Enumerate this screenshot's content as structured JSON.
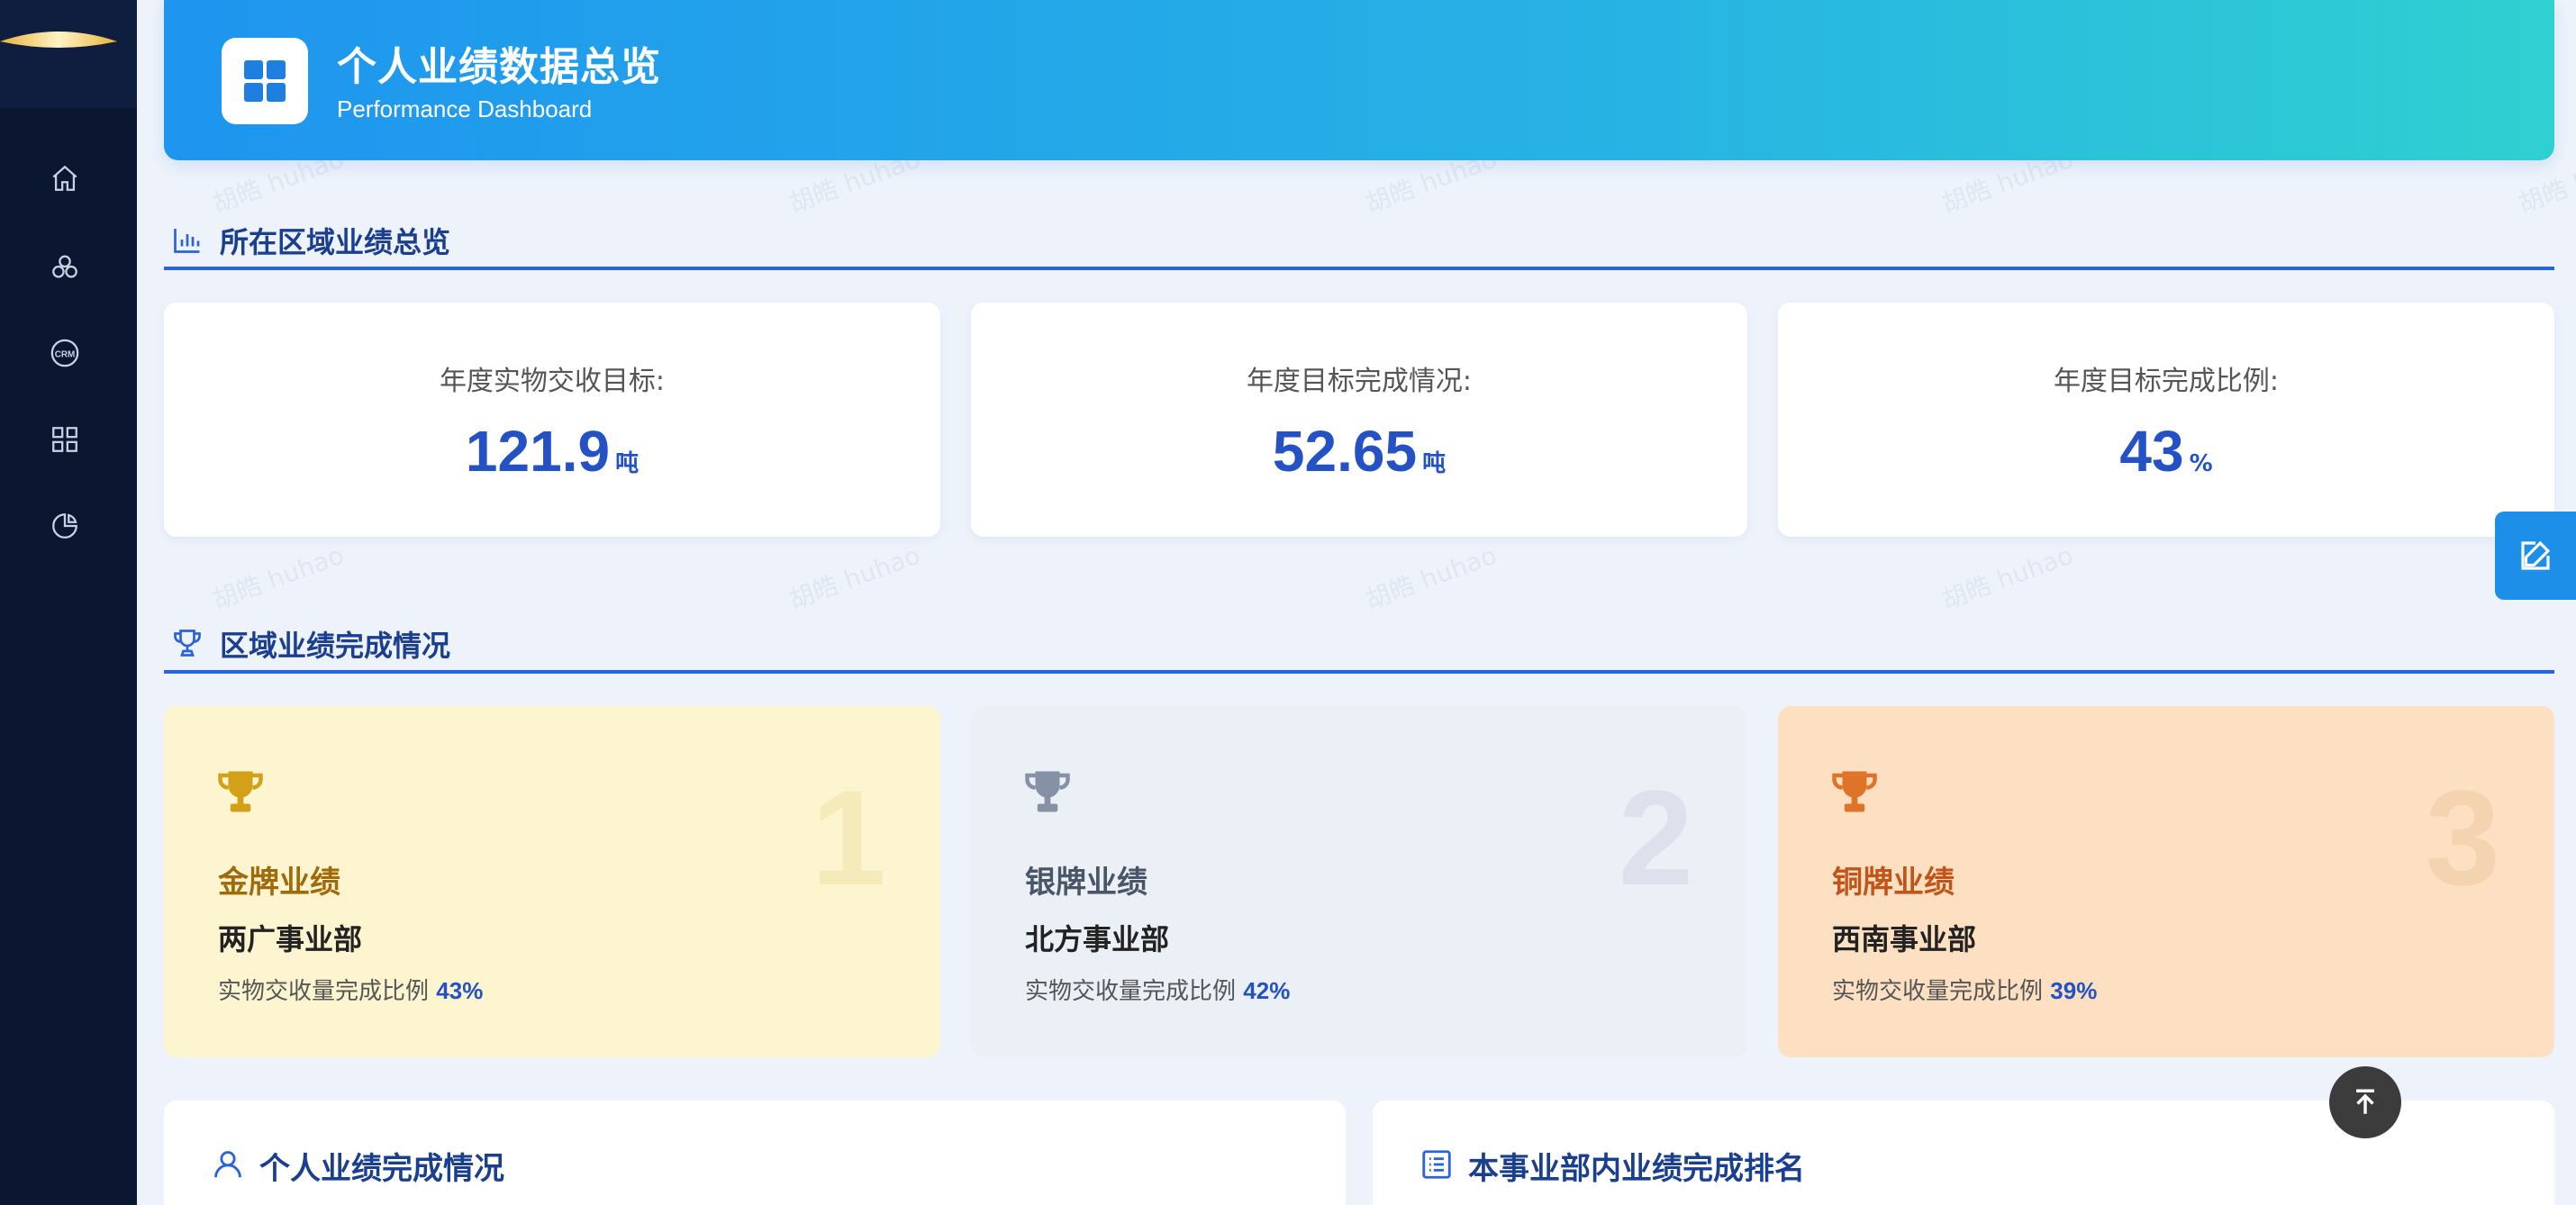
{
  "sidebar": {
    "items": [
      {
        "icon": "home-icon"
      },
      {
        "icon": "modules-icon"
      },
      {
        "icon": "crm-icon",
        "label": "CRM"
      },
      {
        "icon": "grid-icon"
      },
      {
        "icon": "pie-chart-icon"
      }
    ]
  },
  "header": {
    "title": "个人业绩数据总览",
    "subtitle": "Performance Dashboard"
  },
  "region_overview": {
    "title": "所在区域业绩总览",
    "stats": [
      {
        "label": "年度实物交收目标:",
        "value": "121.9",
        "unit": "吨"
      },
      {
        "label": "年度目标完成情况:",
        "value": "52.65",
        "unit": "吨"
      },
      {
        "label": "年度目标完成比例:",
        "value": "43",
        "unit": "%"
      }
    ]
  },
  "region_ranking": {
    "title": "区域业绩完成情况",
    "ratio_label": "实物交收量完成比例",
    "medals": [
      {
        "rank": "1",
        "title": "金牌业绩",
        "dept": "两广事业部",
        "ratio": "43%",
        "color": "#d4a017"
      },
      {
        "rank": "2",
        "title": "银牌业绩",
        "dept": "北方事业部",
        "ratio": "42%",
        "color": "#8791a6"
      },
      {
        "rank": "3",
        "title": "铜牌业绩",
        "dept": "西南事业部",
        "ratio": "39%",
        "color": "#e0732a"
      }
    ]
  },
  "bottom": {
    "personal_title": "个人业绩完成情况",
    "ranking_title": "本事业部内业绩完成排名"
  },
  "watermark": "胡皓 huhao",
  "colors": {
    "accent": "#2b63d9",
    "sidebar": "#0b1631",
    "gold_bg": "#fdf5cf",
    "silver_bg": "#ebeff6",
    "bronze_bg": "#fde0c2"
  }
}
